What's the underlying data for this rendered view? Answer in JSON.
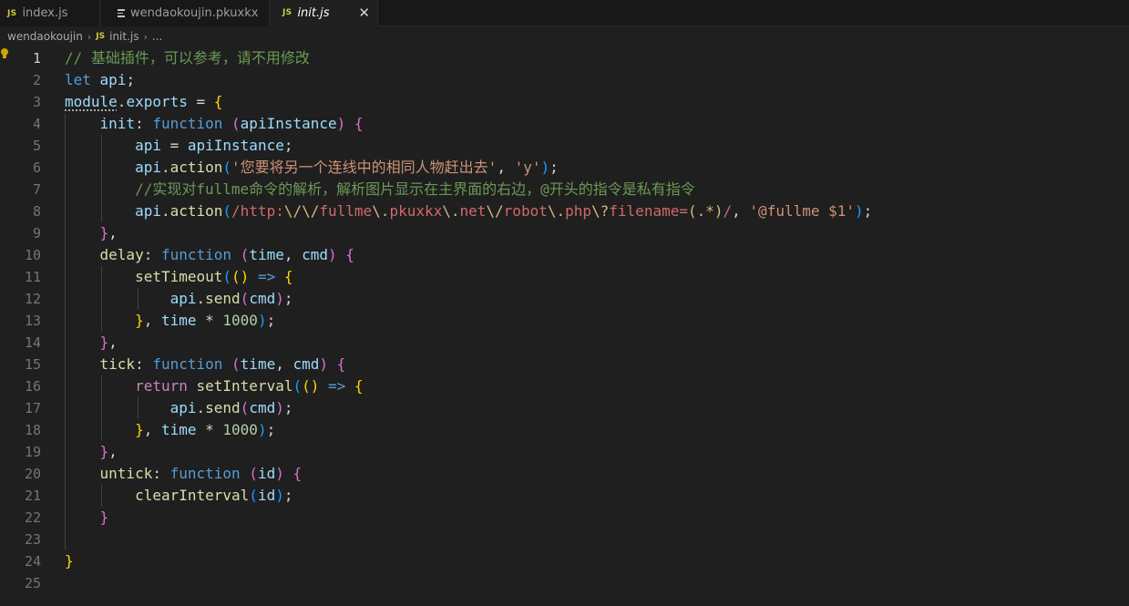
{
  "tabs": [
    {
      "label": "index.js",
      "icon": "JS"
    },
    {
      "label": "wendaokoujin.pkuxkx",
      "icon": "file-lines-icon"
    },
    {
      "label": "init.js",
      "icon": "JS",
      "close": "✕"
    }
  ],
  "breadcrumb": {
    "folder": "wendaokoujin",
    "sep": "›",
    "file_icon": "JS",
    "file": "init.js",
    "ellipsis": "..."
  },
  "editor": {
    "current_line": 1,
    "line_numbers": [
      "1",
      "2",
      "3",
      "4",
      "5",
      "6",
      "7",
      "8",
      "9",
      "10",
      "11",
      "12",
      "13",
      "14",
      "15",
      "16",
      "17",
      "18",
      "19",
      "20",
      "21",
      "22",
      "23",
      "24",
      "25"
    ],
    "lines": [
      [
        {
          "t": "// 基础插件，可以参考，请不用修改",
          "c": "cm"
        }
      ],
      [
        {
          "t": "let",
          "c": "kw"
        },
        {
          "t": " ",
          "c": "def"
        },
        {
          "t": "api",
          "c": "var"
        },
        {
          "t": ";",
          "c": "def"
        }
      ],
      [
        {
          "t": "module",
          "c": "var squig"
        },
        {
          "t": ".",
          "c": "def"
        },
        {
          "t": "exports",
          "c": "var"
        },
        {
          "t": " = ",
          "c": "def"
        },
        {
          "t": "{",
          "c": "b1"
        }
      ],
      [
        {
          "t": "    ",
          "c": "def"
        },
        {
          "t": "init",
          "c": "var"
        },
        {
          "t": ": ",
          "c": "def"
        },
        {
          "t": "function",
          "c": "kw"
        },
        {
          "t": " ",
          "c": "def"
        },
        {
          "t": "(",
          "c": "b2"
        },
        {
          "t": "apiInstance",
          "c": "var"
        },
        {
          "t": ")",
          "c": "b2"
        },
        {
          "t": " ",
          "c": "def"
        },
        {
          "t": "{",
          "c": "b2"
        }
      ],
      [
        {
          "t": "        ",
          "c": "def"
        },
        {
          "t": "api",
          "c": "var"
        },
        {
          "t": " = ",
          "c": "def"
        },
        {
          "t": "apiInstance",
          "c": "var"
        },
        {
          "t": ";",
          "c": "def"
        }
      ],
      [
        {
          "t": "        ",
          "c": "def"
        },
        {
          "t": "api",
          "c": "var"
        },
        {
          "t": ".",
          "c": "def"
        },
        {
          "t": "action",
          "c": "fn"
        },
        {
          "t": "(",
          "c": "b3"
        },
        {
          "t": "'您要将另一个连线中的相同人物赶出去'",
          "c": "str"
        },
        {
          "t": ", ",
          "c": "def"
        },
        {
          "t": "'y'",
          "c": "str"
        },
        {
          "t": ")",
          "c": "b3"
        },
        {
          "t": ";",
          "c": "def"
        }
      ],
      [
        {
          "t": "        ",
          "c": "def"
        },
        {
          "t": "//实现对fullme命令的解析，解析图片显示在主界面的右边，@开头的指令是私有指令",
          "c": "cm"
        }
      ],
      [
        {
          "t": "        ",
          "c": "def"
        },
        {
          "t": "api",
          "c": "var"
        },
        {
          "t": ".",
          "c": "def"
        },
        {
          "t": "action",
          "c": "fn"
        },
        {
          "t": "(",
          "c": "b3"
        },
        {
          "t": "/http:",
          "c": "rx"
        },
        {
          "t": "\\/\\/",
          "c": "rxe"
        },
        {
          "t": "fullme",
          "c": "rx"
        },
        {
          "t": "\\.",
          "c": "rxe"
        },
        {
          "t": "pkuxkx",
          "c": "rx"
        },
        {
          "t": "\\.",
          "c": "rxe"
        },
        {
          "t": "net",
          "c": "rx"
        },
        {
          "t": "\\/",
          "c": "rxe"
        },
        {
          "t": "robot",
          "c": "rx"
        },
        {
          "t": "\\.",
          "c": "rxe"
        },
        {
          "t": "php",
          "c": "rx"
        },
        {
          "t": "\\?",
          "c": "rxe"
        },
        {
          "t": "filename=",
          "c": "rx"
        },
        {
          "t": "(.*)",
          "c": "rxe"
        },
        {
          "t": "/",
          "c": "rx"
        },
        {
          "t": ", ",
          "c": "def"
        },
        {
          "t": "'@fullme $1'",
          "c": "str"
        },
        {
          "t": ")",
          "c": "b3"
        },
        {
          "t": ";",
          "c": "def"
        }
      ],
      [
        {
          "t": "    ",
          "c": "def"
        },
        {
          "t": "}",
          "c": "b2"
        },
        {
          "t": ",",
          "c": "def"
        }
      ],
      [
        {
          "t": "    ",
          "c": "def"
        },
        {
          "t": "delay",
          "c": "fn"
        },
        {
          "t": ": ",
          "c": "def"
        },
        {
          "t": "function",
          "c": "kw"
        },
        {
          "t": " ",
          "c": "def"
        },
        {
          "t": "(",
          "c": "b2"
        },
        {
          "t": "time",
          "c": "var"
        },
        {
          "t": ", ",
          "c": "def"
        },
        {
          "t": "cmd",
          "c": "var"
        },
        {
          "t": ")",
          "c": "b2"
        },
        {
          "t": " ",
          "c": "def"
        },
        {
          "t": "{",
          "c": "b2"
        }
      ],
      [
        {
          "t": "        ",
          "c": "def"
        },
        {
          "t": "setTimeout",
          "c": "fn"
        },
        {
          "t": "(",
          "c": "b3"
        },
        {
          "t": "()",
          "c": "b1"
        },
        {
          "t": " ",
          "c": "def"
        },
        {
          "t": "=>",
          "c": "kw"
        },
        {
          "t": " ",
          "c": "def"
        },
        {
          "t": "{",
          "c": "b1"
        }
      ],
      [
        {
          "t": "            ",
          "c": "def"
        },
        {
          "t": "api",
          "c": "var"
        },
        {
          "t": ".",
          "c": "def"
        },
        {
          "t": "send",
          "c": "fn"
        },
        {
          "t": "(",
          "c": "b2"
        },
        {
          "t": "cmd",
          "c": "var"
        },
        {
          "t": ")",
          "c": "b2"
        },
        {
          "t": ";",
          "c": "def"
        }
      ],
      [
        {
          "t": "        ",
          "c": "def"
        },
        {
          "t": "}",
          "c": "b1"
        },
        {
          "t": ", ",
          "c": "def"
        },
        {
          "t": "time",
          "c": "var"
        },
        {
          "t": " * ",
          "c": "def"
        },
        {
          "t": "1000",
          "c": "num"
        },
        {
          "t": ")",
          "c": "b3"
        },
        {
          "t": ";",
          "c": "def"
        }
      ],
      [
        {
          "t": "    ",
          "c": "def"
        },
        {
          "t": "}",
          "c": "b2"
        },
        {
          "t": ",",
          "c": "def"
        }
      ],
      [
        {
          "t": "    ",
          "c": "def"
        },
        {
          "t": "tick",
          "c": "fn"
        },
        {
          "t": ": ",
          "c": "def"
        },
        {
          "t": "function",
          "c": "kw"
        },
        {
          "t": " ",
          "c": "def"
        },
        {
          "t": "(",
          "c": "b2"
        },
        {
          "t": "time",
          "c": "var"
        },
        {
          "t": ", ",
          "c": "def"
        },
        {
          "t": "cmd",
          "c": "var"
        },
        {
          "t": ")",
          "c": "b2"
        },
        {
          "t": " ",
          "c": "def"
        },
        {
          "t": "{",
          "c": "b2"
        }
      ],
      [
        {
          "t": "        ",
          "c": "def"
        },
        {
          "t": "return",
          "c": "ctl"
        },
        {
          "t": " ",
          "c": "def"
        },
        {
          "t": "setInterval",
          "c": "fn"
        },
        {
          "t": "(",
          "c": "b3"
        },
        {
          "t": "()",
          "c": "b1"
        },
        {
          "t": " ",
          "c": "def"
        },
        {
          "t": "=>",
          "c": "kw"
        },
        {
          "t": " ",
          "c": "def"
        },
        {
          "t": "{",
          "c": "b1"
        }
      ],
      [
        {
          "t": "            ",
          "c": "def"
        },
        {
          "t": "api",
          "c": "var"
        },
        {
          "t": ".",
          "c": "def"
        },
        {
          "t": "send",
          "c": "fn"
        },
        {
          "t": "(",
          "c": "b2"
        },
        {
          "t": "cmd",
          "c": "var"
        },
        {
          "t": ")",
          "c": "b2"
        },
        {
          "t": ";",
          "c": "def"
        }
      ],
      [
        {
          "t": "        ",
          "c": "def"
        },
        {
          "t": "}",
          "c": "b1"
        },
        {
          "t": ", ",
          "c": "def"
        },
        {
          "t": "time",
          "c": "var"
        },
        {
          "t": " * ",
          "c": "def"
        },
        {
          "t": "1000",
          "c": "num"
        },
        {
          "t": ")",
          "c": "b3"
        },
        {
          "t": ";",
          "c": "def"
        }
      ],
      [
        {
          "t": "    ",
          "c": "def"
        },
        {
          "t": "}",
          "c": "b2"
        },
        {
          "t": ",",
          "c": "def"
        }
      ],
      [
        {
          "t": "    ",
          "c": "def"
        },
        {
          "t": "untick",
          "c": "fn"
        },
        {
          "t": ": ",
          "c": "def"
        },
        {
          "t": "function",
          "c": "kw"
        },
        {
          "t": " ",
          "c": "def"
        },
        {
          "t": "(",
          "c": "b2"
        },
        {
          "t": "id",
          "c": "var"
        },
        {
          "t": ")",
          "c": "b2"
        },
        {
          "t": " ",
          "c": "def"
        },
        {
          "t": "{",
          "c": "b2"
        }
      ],
      [
        {
          "t": "        ",
          "c": "def"
        },
        {
          "t": "clearInterval",
          "c": "fn"
        },
        {
          "t": "(",
          "c": "b3"
        },
        {
          "t": "id",
          "c": "var"
        },
        {
          "t": ")",
          "c": "b3"
        },
        {
          "t": ";",
          "c": "def"
        }
      ],
      [
        {
          "t": "    ",
          "c": "def"
        },
        {
          "t": "}",
          "c": "b2"
        }
      ],
      [],
      [
        {
          "t": "}",
          "c": "b1"
        }
      ],
      []
    ]
  }
}
